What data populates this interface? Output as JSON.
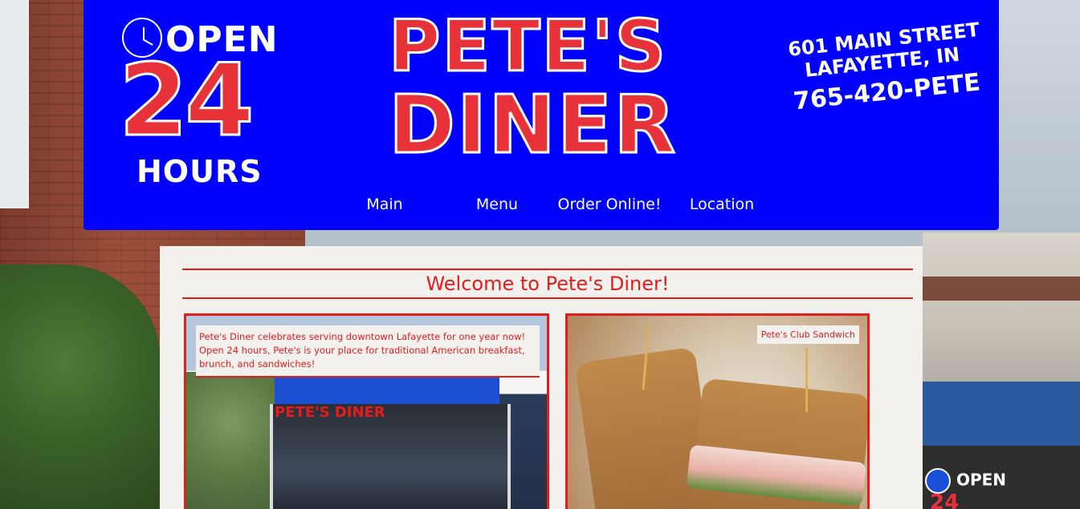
{
  "header": {
    "open_badge": {
      "open": "OPEN",
      "hours_number": "24",
      "hours_label": "HOURS"
    },
    "logo": {
      "line1": "PETE'S",
      "line2": "DINER"
    },
    "address": {
      "street": "601 MAIN STREET",
      "city": "LAFAYETTE, IN",
      "phone": "765-420-PETE"
    }
  },
  "nav": {
    "items": [
      {
        "label": "Main"
      },
      {
        "label": "Menu"
      },
      {
        "label": "Order Online!"
      },
      {
        "label": "Location"
      }
    ]
  },
  "main": {
    "welcome_title": "Welcome to Pete's Diner!",
    "cards": [
      {
        "caption": "Pete's Diner celebrates serving downtown Lafayette for one year now! Open 24 hours, Pete's is your place for traditional American breakfast, brunch, and sandwiches!",
        "image_sign": "PETE'S DINER"
      },
      {
        "caption": "Pete's Club Sandwich"
      }
    ]
  },
  "background": {
    "sign": {
      "open": "OPEN",
      "number": "24"
    }
  },
  "colors": {
    "header_blue": "#0000fe",
    "brand_red": "#e8323a",
    "accent_red": "#e41c1c",
    "content_bg": "#f3f1ee"
  }
}
